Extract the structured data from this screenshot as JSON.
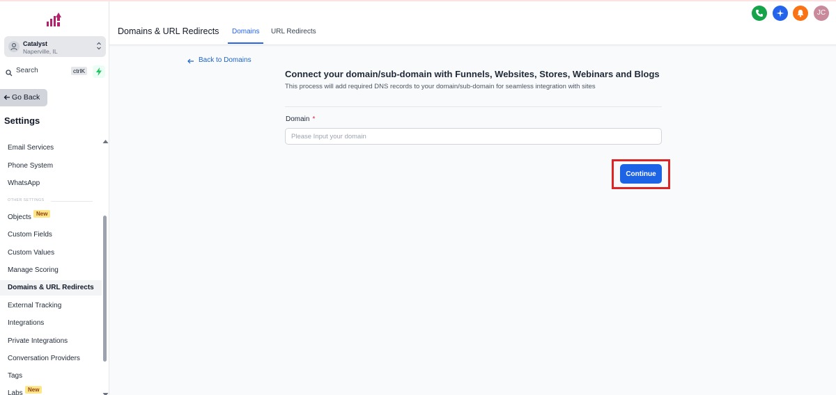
{
  "account": {
    "name": "Catalyst",
    "location": "Naperville, IL"
  },
  "search": {
    "label": "Search",
    "shortcut": "ctrlK"
  },
  "sidebar": {
    "go_back": "Go Back",
    "title": "Settings",
    "section_other": "OTHER SETTINGS",
    "new_badge": "New",
    "items": [
      {
        "label": "Email Services"
      },
      {
        "label": "Phone System"
      },
      {
        "label": "WhatsApp"
      },
      {
        "label": "Objects"
      },
      {
        "label": "Custom Fields"
      },
      {
        "label": "Custom Values"
      },
      {
        "label": "Manage Scoring"
      },
      {
        "label": "Domains & URL Redirects"
      },
      {
        "label": "External Tracking"
      },
      {
        "label": "Integrations"
      },
      {
        "label": "Private Integrations"
      },
      {
        "label": "Conversation Providers"
      },
      {
        "label": "Tags"
      },
      {
        "label": "Labs"
      }
    ],
    "active_item": "Domains & URL Redirects"
  },
  "header": {
    "title": "Domains & URL Redirects",
    "tabs": [
      {
        "label": "Domains"
      },
      {
        "label": "URL Redirects"
      }
    ],
    "active_tab": "Domains",
    "user_initials": "JC",
    "icon_colors": {
      "phone": "#16a34a",
      "ai": "#2563eb",
      "notifications": "#f97316"
    }
  },
  "main": {
    "back_link": "Back to Domains",
    "title": "Connect your domain/sub-domain with Funnels, Websites, Stores, Webinars and Blogs",
    "subtitle": "This process will add required DNS records to your domain/sub-domain for seamless integration with sites",
    "domain_label": "Domain",
    "required_mark": "*",
    "domain_placeholder": "Please Input your domain",
    "domain_value": "",
    "continue_label": "Continue"
  }
}
